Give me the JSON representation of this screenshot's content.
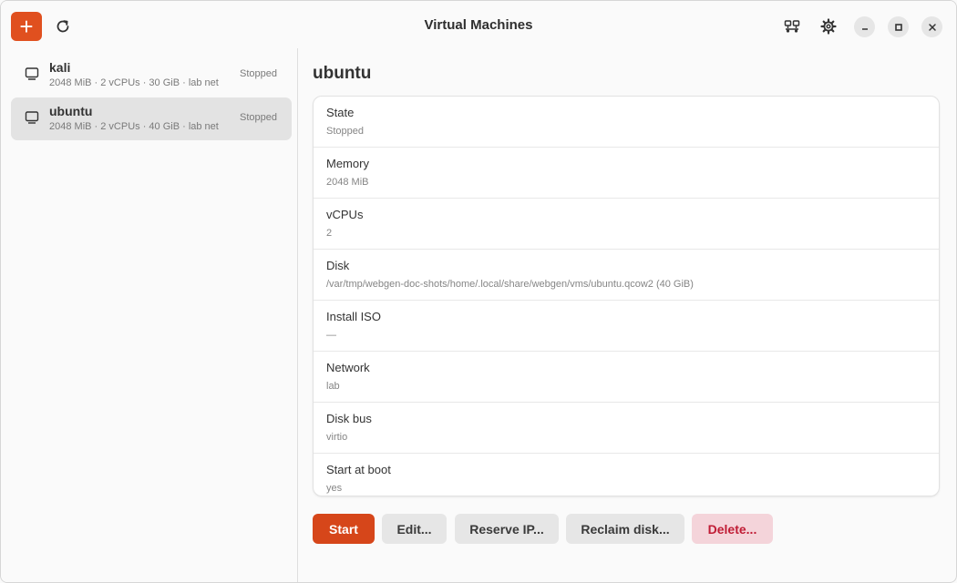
{
  "header": {
    "title": "Virtual Machines",
    "add_label": "+"
  },
  "colors": {
    "accent": "#e0501f",
    "danger_text": "#c01c35",
    "danger_bg": "#f4d4da"
  },
  "vms": [
    {
      "name": "kali",
      "details": "2048 MiB · 2 vCPUs · 30 GiB · lab net",
      "status": "Stopped",
      "selected": false
    },
    {
      "name": "ubuntu",
      "details": "2048 MiB · 2 vCPUs · 40 GiB · lab net",
      "status": "Stopped",
      "selected": true
    }
  ],
  "detail": {
    "title": "ubuntu",
    "properties": [
      {
        "label": "State",
        "value": "Stopped"
      },
      {
        "label": "Memory",
        "value": "2048 MiB"
      },
      {
        "label": "vCPUs",
        "value": "2"
      },
      {
        "label": "Disk",
        "value": "/var/tmp/webgen-doc-shots/home/.local/share/webgen/vms/ubuntu.qcow2 (40 GiB)"
      },
      {
        "label": "Install ISO",
        "value": "—"
      },
      {
        "label": "Network",
        "value": "lab"
      },
      {
        "label": "Disk bus",
        "value": "virtio"
      },
      {
        "label": "Start at boot",
        "value": "yes"
      }
    ]
  },
  "actions": {
    "start": "Start",
    "edit": "Edit...",
    "reserve_ip": "Reserve IP...",
    "reclaim_disk": "Reclaim disk...",
    "delete": "Delete..."
  }
}
